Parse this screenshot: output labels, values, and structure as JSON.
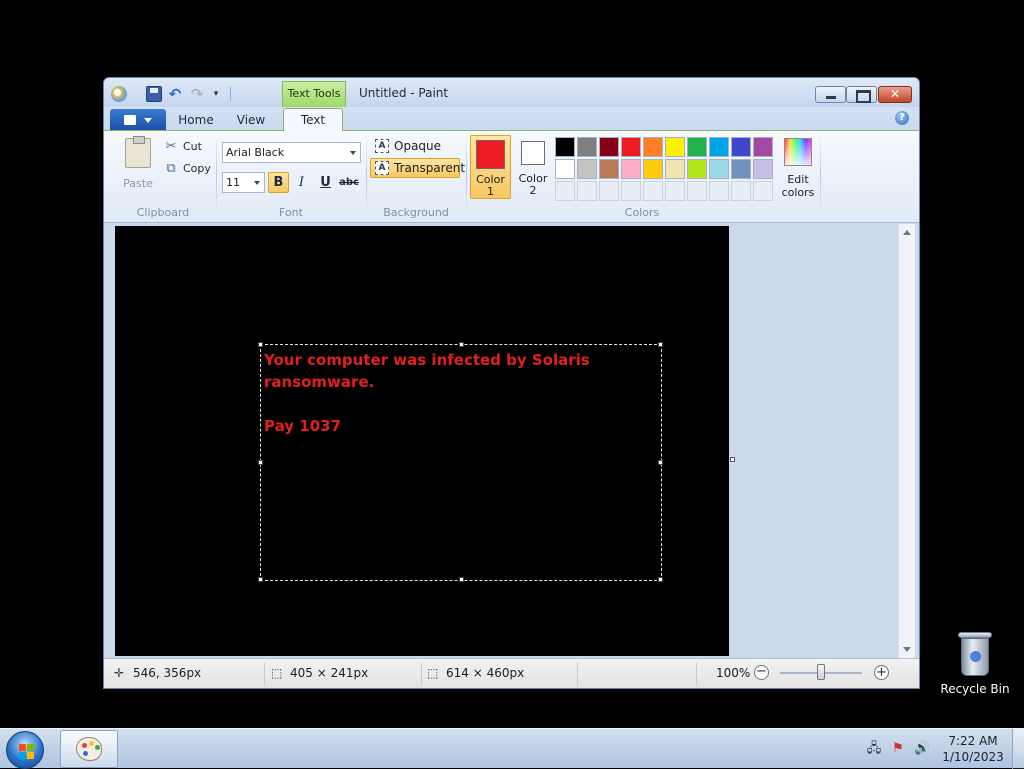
{
  "window": {
    "title": "Untitled - Paint",
    "contextual_tab": "Text Tools",
    "close_glyph": "✕"
  },
  "quick_access": {
    "undo_glyph": "↶",
    "redo_glyph": "↷",
    "more_glyph": "▾"
  },
  "ribbon_tabs": {
    "home": "Home",
    "view": "View",
    "text": "Text",
    "help_glyph": "?"
  },
  "clipboard": {
    "paste": "Paste",
    "cut": "Cut",
    "copy": "Copy",
    "cut_glyph": "✂",
    "copy_glyph": "⧉",
    "group": "Clipboard"
  },
  "font": {
    "family": "Arial Black",
    "size": "11",
    "bold": "B",
    "italic": "I",
    "underline": "U",
    "strikethrough": "abc",
    "group": "Font"
  },
  "background": {
    "opaque": "Opaque",
    "transparent": "Transparent",
    "icon_glyph": "A",
    "group": "Background",
    "selected": "Transparent"
  },
  "colors": {
    "color1_label": "Color 1",
    "color1_line1": "Color",
    "color1_line2": "1",
    "color2_line1": "Color",
    "color2_line2": "2",
    "color1": "#ed1c24",
    "color2": "#ffffff",
    "palette_row1": [
      "#000000",
      "#7f7f7f",
      "#880015",
      "#ed1c24",
      "#ff7f27",
      "#fff200",
      "#22b14c",
      "#00a2e8",
      "#3f48cc",
      "#a349a4"
    ],
    "palette_row2": [
      "#ffffff",
      "#c3c3c3",
      "#b97a57",
      "#ffaec9",
      "#ffc90e",
      "#efe4b0",
      "#b5e61d",
      "#99d9ea",
      "#7092be",
      "#c8bfe7"
    ],
    "edit_colors_line1": "Edit",
    "edit_colors_line2": "colors",
    "group": "Colors"
  },
  "canvas": {
    "text_lines": [
      "Your computer was infected by Solaris",
      "ransomware.",
      "",
      "Pay 1037"
    ],
    "text_color": "#e02020",
    "background_color": "#000000"
  },
  "status": {
    "cursor_pos": "546, 356px",
    "selection_size": "405 × 241px",
    "image_size": "614 × 460px",
    "zoom": "100%",
    "zoom_level": 1.0,
    "pos_glyph": "✛",
    "zoom_out_glyph": "−",
    "zoom_in_glyph": "+"
  },
  "desktop": {
    "recycle_bin": "Recycle Bin"
  },
  "taskbar": {
    "time": "7:22 AM",
    "date": "1/10/2023",
    "net_glyph": "🖧",
    "flag_glyph": "⚑",
    "volume_glyph": "🔊"
  }
}
